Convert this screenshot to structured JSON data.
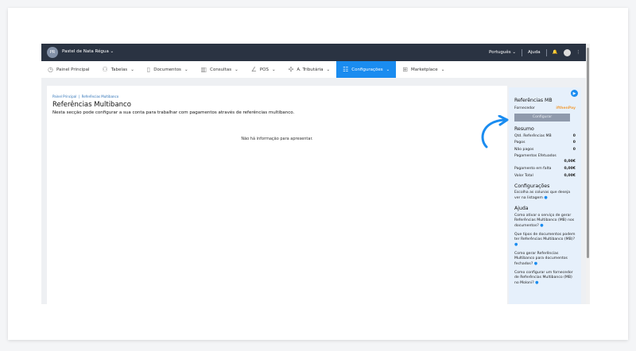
{
  "topbar": {
    "avatar_initials": "PR",
    "company": "Pastel de Nata Régua",
    "language": "Português",
    "help": "Ajuda"
  },
  "nav": [
    {
      "label": "Painel Principal",
      "icon": "clock-icon"
    },
    {
      "label": "Tabelas",
      "icon": "user-icon"
    },
    {
      "label": "Documentos",
      "icon": "document-icon"
    },
    {
      "label": "Consultas",
      "icon": "chart-icon"
    },
    {
      "label": "POS",
      "icon": "pos-icon"
    },
    {
      "label": "A. Tributária",
      "icon": "tax-icon"
    },
    {
      "label": "Configurações",
      "icon": "settings-icon",
      "active": true
    },
    {
      "label": "Marketplace",
      "icon": "grid-icon"
    }
  ],
  "breadcrumb": {
    "home": "Painel Principal",
    "current": "Referências Multibanco"
  },
  "page": {
    "title": "Referências Multibanco",
    "subtitle": "Nesta secção pode configurar a sua conta para trabalhar com pagamentos através de referências multibanco.",
    "empty": "Não há informação para apresentar."
  },
  "sidebar": {
    "mb_title": "Referências MB",
    "supplier_label": "Fornecedor",
    "supplier_value": "ifthenPay",
    "configure": "Configurar",
    "summary_title": "Resumo",
    "summary": [
      {
        "label": "Qtd. Referências MB",
        "value": "0"
      },
      {
        "label": "Pagos",
        "value": "0"
      },
      {
        "label": "Não pagos",
        "value": "0"
      }
    ],
    "paid_label": "Pagamentos Efetuados",
    "paid_value": "0,00€",
    "missing_label": "Pagamento em falta",
    "missing_value": "0,00€",
    "total_label": "Valor Total",
    "total_value": "0,00€",
    "config_title": "Configurações",
    "config_text": "Escolha as colunas que deseja ver na listagem",
    "help_title": "Ajuda",
    "help": [
      "Como ativar o serviço de gerar Referências Multibanco (MB) nos documentos?",
      "Que tipos de documentos podem ter Referências Multibanco (MB)?",
      "Como gerar Referências Multibanco para documentos fechados?",
      "Como configurar um fornecedor de Referências Multibanco (MB) no Moloni?"
    ]
  },
  "colors": {
    "topbar": "#2a3342",
    "accent": "#1a8cf0",
    "supplier": "#f0a040",
    "sidebar": "#e6f0fb"
  }
}
